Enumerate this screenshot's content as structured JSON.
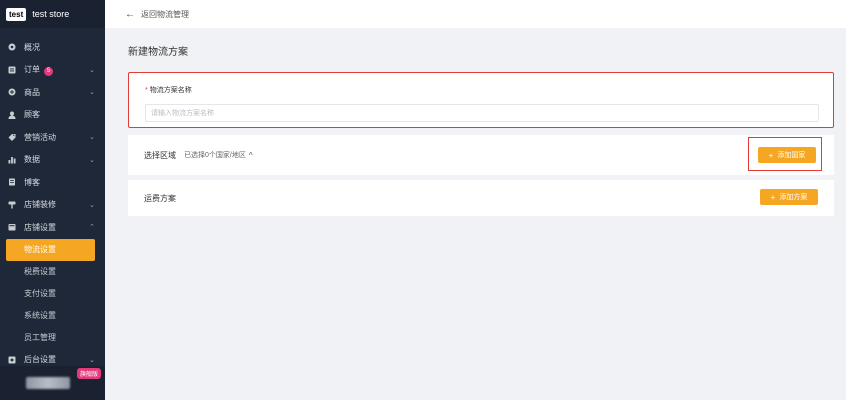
{
  "brand": {
    "logo_text": "test",
    "store_name": "test store"
  },
  "sidebar": {
    "items": [
      {
        "label": "概况",
        "icon": "dashboard-icon",
        "has_chevron": false
      },
      {
        "label": "订单",
        "icon": "orders-icon",
        "has_chevron": true,
        "badge": "5"
      },
      {
        "label": "商品",
        "icon": "products-icon",
        "has_chevron": true
      },
      {
        "label": "顾客",
        "icon": "customers-icon",
        "has_chevron": false
      },
      {
        "label": "营销活动",
        "icon": "marketing-icon",
        "has_chevron": true
      },
      {
        "label": "数据",
        "icon": "analytics-icon",
        "has_chevron": true
      },
      {
        "label": "博客",
        "icon": "blog-icon",
        "has_chevron": false
      },
      {
        "label": "店铺装修",
        "icon": "theme-icon",
        "has_chevron": true
      },
      {
        "label": "店铺设置",
        "icon": "store-settings-icon",
        "has_chevron": true,
        "expanded": true
      }
    ],
    "sub_items": [
      {
        "label": "物流设置",
        "active": true
      },
      {
        "label": "税费设置",
        "active": false
      },
      {
        "label": "支付设置",
        "active": false
      },
      {
        "label": "系统设置",
        "active": false
      },
      {
        "label": "员工管理",
        "active": false
      }
    ],
    "after": {
      "label": "后台设置",
      "icon": "admin-settings-icon",
      "has_chevron": true
    },
    "plan_badge": "旗舰版"
  },
  "topbar": {
    "back_label": "返回物流管理"
  },
  "page": {
    "title": "新建物流方案"
  },
  "form": {
    "name_label": "物流方案名称",
    "name_placeholder": "请输入物流方案名称",
    "name_value": ""
  },
  "region": {
    "title": "选择区域",
    "meta": "已选择0个国家/地区",
    "add_button": "添加国家"
  },
  "shipping": {
    "title": "运费方案",
    "add_button": "添加方案"
  },
  "colors": {
    "accent": "#f5a623",
    "sidebar_bg": "#1f2838",
    "highlight": "#e53935",
    "badge": "#e5397c"
  }
}
